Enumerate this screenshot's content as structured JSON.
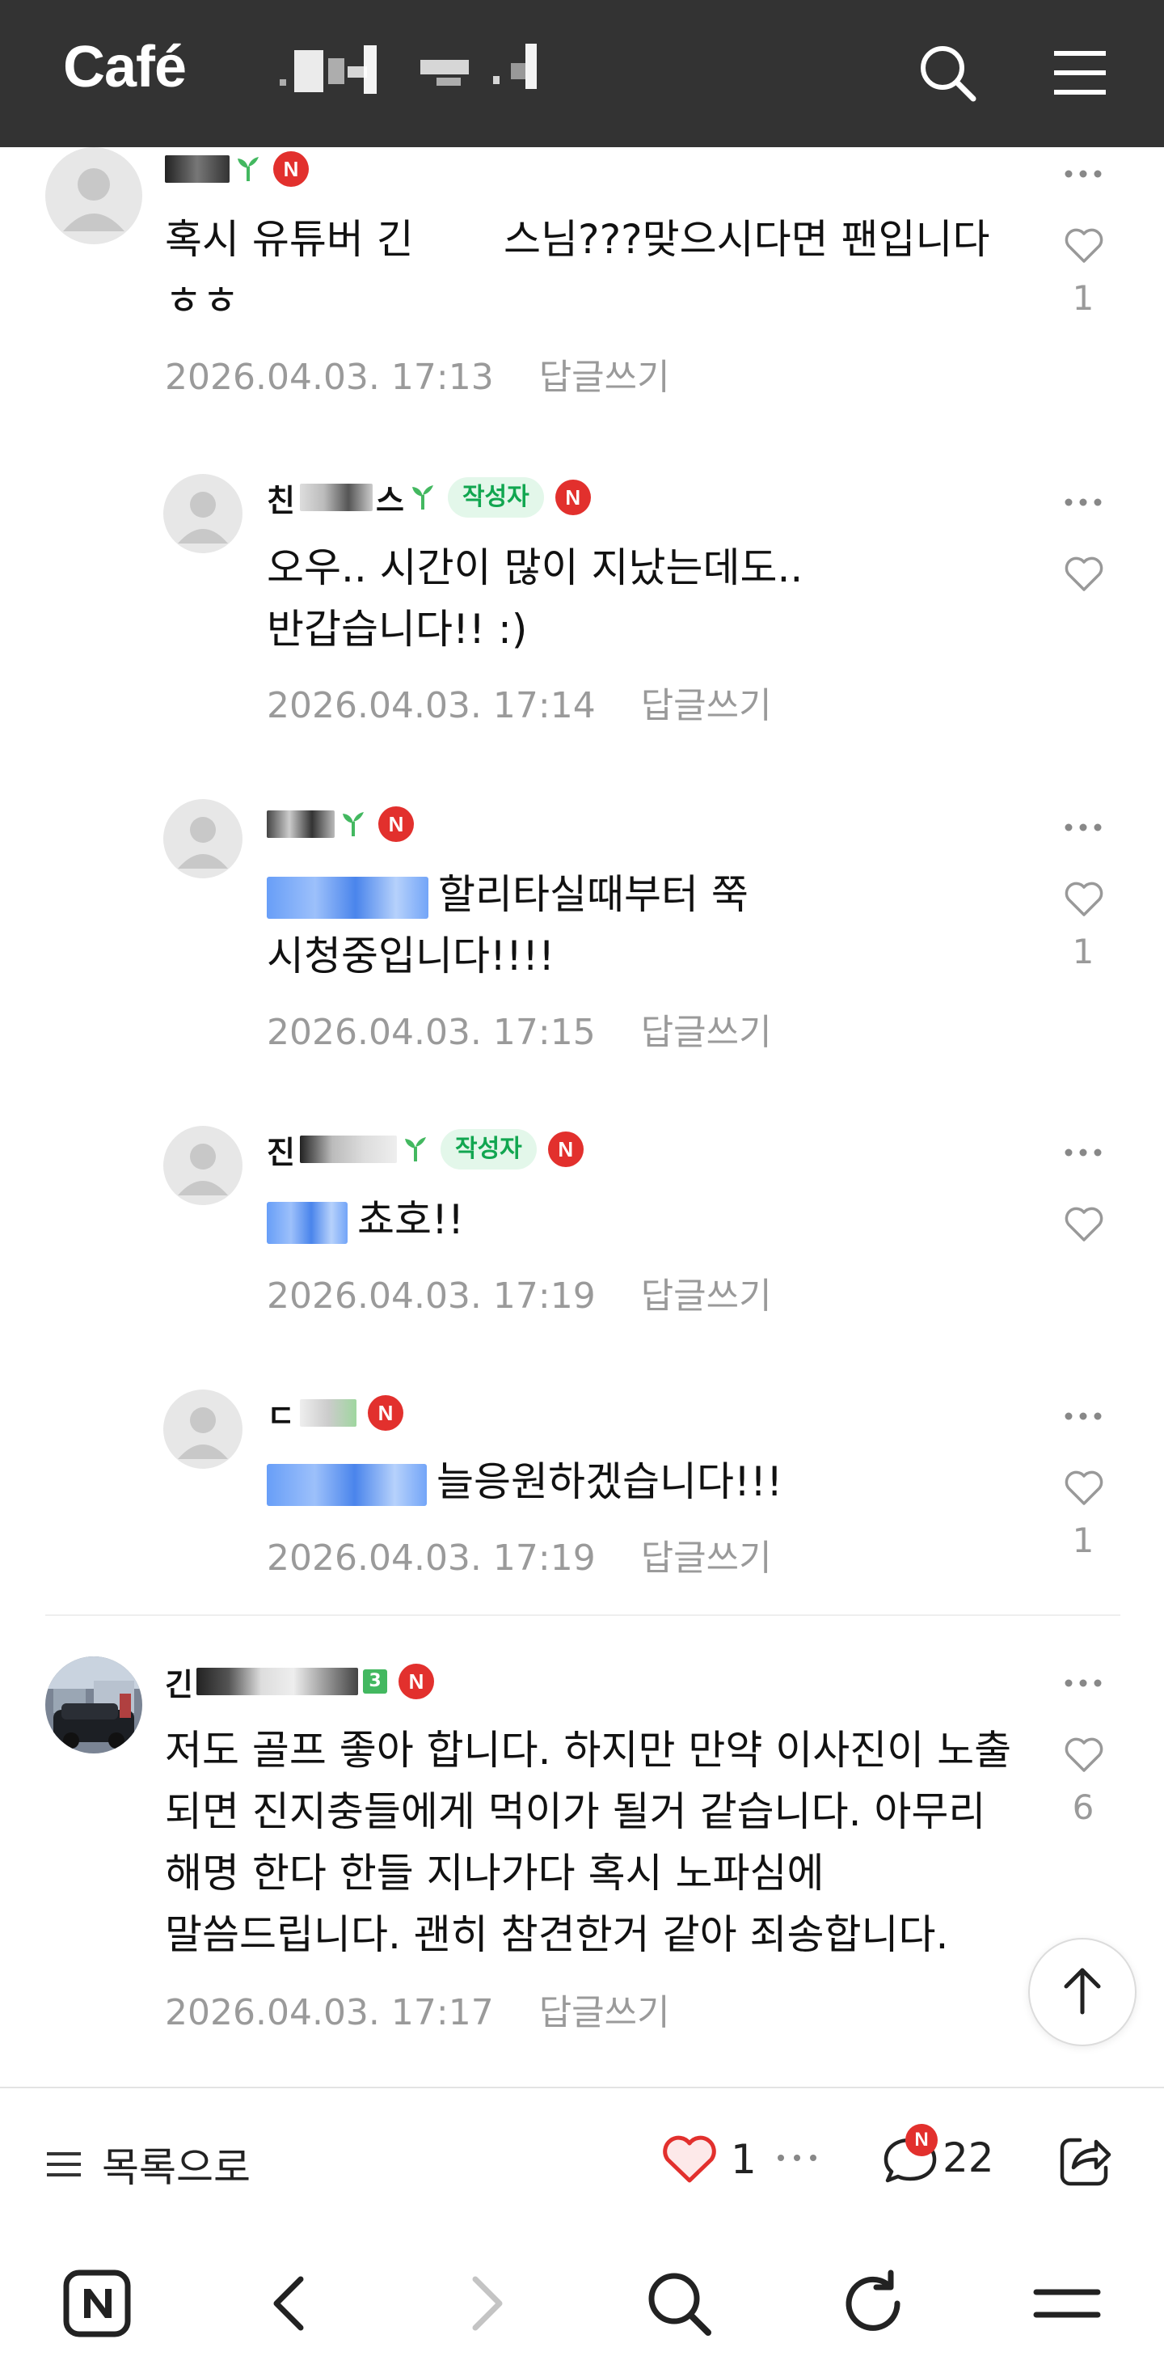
{
  "header": {
    "brand": "Café"
  },
  "comments": [
    {
      "text": "혹시 유튜버 긴       스님???맞으시다면 팬입니다 ㅎㅎ",
      "timestamp": "2026.04.03. 17:13",
      "reply_label": "답글쓰기",
      "likes": "1"
    },
    {
      "author_first": "친",
      "author_last": "스",
      "writer_badge": "작성자",
      "text": "오우.. 시간이 많이 지났는데도.. 반갑습니다!! :)",
      "timestamp": "2026.04.03. 17:14",
      "reply_label": "답글쓰기",
      "likes": ""
    },
    {
      "text": "할리타실때부터 쭉 시청중입니다!!!!",
      "timestamp": "2026.04.03. 17:15",
      "reply_label": "답글쓰기",
      "likes": "1"
    },
    {
      "author_first": "진",
      "writer_badge": "작성자",
      "text": "쵸호!!",
      "timestamp": "2026.04.03. 17:19",
      "reply_label": "답글쓰기",
      "likes": ""
    },
    {
      "author_first": "ㄷ",
      "text": "늘응원하겠습니다!!!",
      "timestamp": "2026.04.03. 17:19",
      "reply_label": "답글쓰기",
      "likes": "1"
    },
    {
      "author_first": "긴",
      "level": "3",
      "text": "저도 골프 좋아 합니다. 하지만 만약 이사진이 노출 되면 진지충들에게 먹이가 될거 같습니다. 아무리 해명 한다 한들 지나가다 혹시 노파심에 말씀드립니다. 괜히 참견한거 같아 죄송합니다.",
      "timestamp": "2026.04.03. 17:17",
      "reply_label": "답글쓰기",
      "likes": "6"
    }
  ],
  "n_badge": "N",
  "actionbar": {
    "list_label": "목록으로",
    "like_count": "1",
    "comment_count": "22",
    "comment_badge": "N"
  },
  "colors": {
    "header_bg": "#333333",
    "n_badge": "#e2302d",
    "writer_badge_bg": "#e3f7ea",
    "writer_badge_text": "#11a650",
    "like_heart": "#e2302d",
    "meta_text": "#9a9a9a"
  },
  "icons": [
    "search-icon",
    "menu-icon",
    "more-icon",
    "heart-outline-icon",
    "heart-filled-icon",
    "comment-icon",
    "share-icon",
    "arrow-up-icon",
    "naver-home-icon",
    "back-icon",
    "forward-icon",
    "refresh-icon",
    "hamburger-icon"
  ]
}
